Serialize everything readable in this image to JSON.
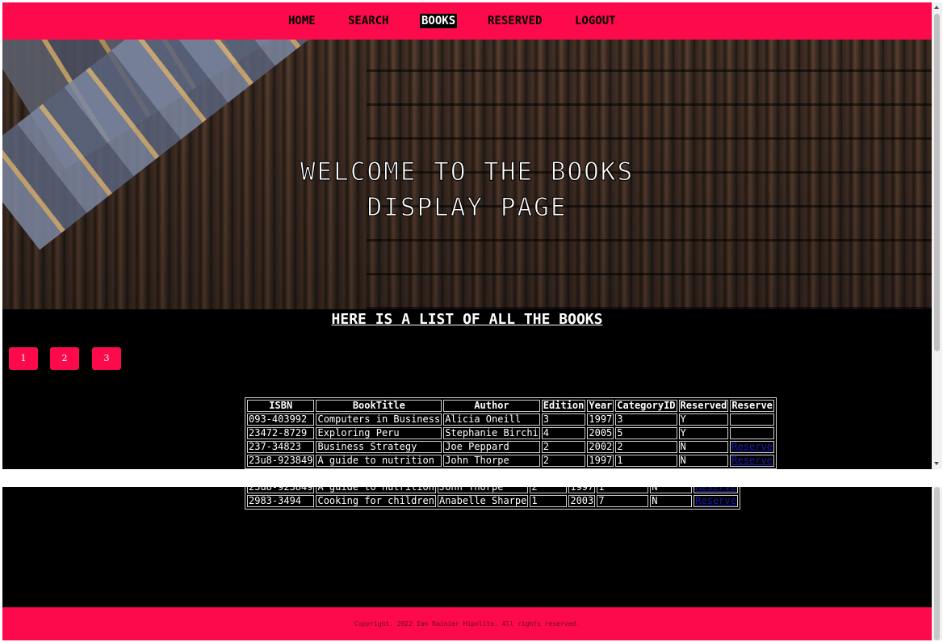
{
  "nav": {
    "items": [
      {
        "label": "HOME"
      },
      {
        "label": "SEARCH"
      },
      {
        "label": "BOOKS"
      },
      {
        "label": "RESERVED"
      },
      {
        "label": "LOGOUT"
      }
    ]
  },
  "hero": {
    "title_line1": "WELCOME TO THE BOOKS",
    "title_line2": "DISPLAY PAGE"
  },
  "section": {
    "heading": "HERE IS A LIST OF ALL THE BOOKS"
  },
  "pagination": {
    "pages": [
      "1",
      "2",
      "3"
    ]
  },
  "table": {
    "headers": [
      "ISBN",
      "BookTitle",
      "Author",
      "Edition",
      "Year",
      "CategoryID",
      "Reserved",
      "Reserve"
    ],
    "rows": [
      {
        "isbn": "093-403992",
        "title": "Computers in Business",
        "author": "Alicia Oneill",
        "edition": "3",
        "year": "1997",
        "category": "3",
        "reserved": "Y",
        "reserve": ""
      },
      {
        "isbn": "23472-8729",
        "title": "Exploring Peru",
        "author": "Stephanie Birchi",
        "edition": "4",
        "year": "2005",
        "category": "5",
        "reserved": "Y",
        "reserve": ""
      },
      {
        "isbn": "237-34823",
        "title": "Business Strategy",
        "author": "Joe Peppard",
        "edition": "2",
        "year": "2002",
        "category": "2",
        "reserved": "N",
        "reserve": "Reserve"
      },
      {
        "isbn": "23u8-923849",
        "title": "A guide to nutrition",
        "author": "John Thorpe",
        "edition": "2",
        "year": "1997",
        "category": "1",
        "reserved": "N",
        "reserve": "Reserve"
      }
    ],
    "continued_rows": [
      {
        "isbn": "2983-3494",
        "title": "Cooking for children",
        "author": "Anabelle Sharpe",
        "edition": "1",
        "year": "2003",
        "category": "7",
        "reserved": "N",
        "reserve": "Reserve"
      }
    ]
  },
  "footer": {
    "copyright": "Copyright. 2022 Ian Rainier Hipolito. All rights reserved."
  },
  "colors": {
    "accent": "#fc0a4c",
    "background": "#000000",
    "link": "#1a1aa8"
  }
}
